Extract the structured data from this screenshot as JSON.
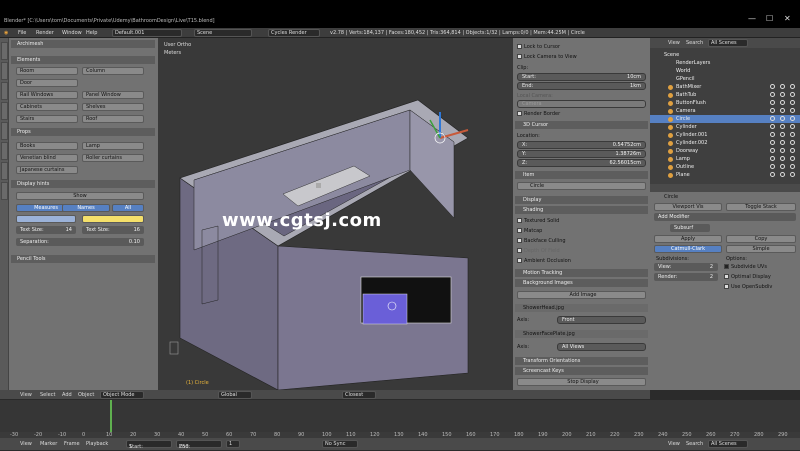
{
  "window": {
    "title": "Blender* [C:\\Users\\tom\\Documents\\Private\\Udemy\\BathroomDesign\\Live\\T15.blend]",
    "minimize": "—",
    "maximize": "☐",
    "close": "✕"
  },
  "info_header": {
    "menus": [
      "File",
      "Render",
      "Window",
      "Help"
    ],
    "layout": "Default.001",
    "scene": "Scene",
    "engine": "Cycles Render",
    "stats": "v2.78 | Verts:184,137 | Faces:180,452 | Tris:364,814 | Objects:1/32 | Lamps:0/0 | Mem:44.25M | Circle"
  },
  "tool_shelf": {
    "addon_header": "Archimesh",
    "elements_header": "Elements",
    "elements": [
      "Room",
      "Column",
      "Door",
      "Rail Windows",
      "Panel Window",
      "Cabinets",
      "Shelves",
      "Stairs",
      "Roof"
    ],
    "props_header": "Props",
    "props": [
      "Books",
      "Lamp",
      "Venetian blind",
      "Roller curtains",
      "Japanese curtains"
    ],
    "display_header": "Display hints",
    "show_label": "Show",
    "measures_label": "Measures",
    "names_label": "Names",
    "all_label": "All",
    "text_size_a_label": "Text Size:",
    "text_size_a_value": "14",
    "text_size_b_label": "Text Size:",
    "text_size_b_value": "16",
    "separation_label": "Separation:",
    "separation_value": "0.10",
    "pencil_header": "Pencil Tools"
  },
  "viewport": {
    "view_label": "User Ortho",
    "units_label": "Meters",
    "object_label": "(1) Circle",
    "watermark": "www.cgtsj.com"
  },
  "n_panel": {
    "lock_to_cursor": "Lock to Cursor",
    "lock_camera": "Lock Camera to View",
    "clip_label": "Clip:",
    "clip_start_label": "Start:",
    "clip_start_value": "10cm",
    "clip_end_label": "End:",
    "clip_end_value": "1km",
    "local_camera_label": "Local Camera:",
    "camera_field": "Camera",
    "render_border": "Render Border",
    "cursor_header": "3D Cursor",
    "location_label": "Location:",
    "loc_x_label": "X:",
    "loc_x_value": "0.54752cm",
    "loc_y_label": "Y:",
    "loc_y_value": "1.38726m",
    "loc_z_label": "Z:",
    "loc_z_value": "62.56015cm",
    "item_header": "Item",
    "item_name": "Circle",
    "display_header": "Display",
    "shading_header": "Shading",
    "textured_solid": "Textured Solid",
    "matcap": "Matcap",
    "backface_culling": "Backface Culling",
    "depth_of_field": "Depth Of Field",
    "ambient_occlusion": "Ambient Occlusion",
    "motion_tracking": "Motion Tracking",
    "bg_images_header": "Background Images",
    "add_image": "Add Image",
    "image1_name": "ShowerHead.jpg",
    "axis_label": "Axis:",
    "image1_axis": "Front",
    "image2_name": "ShowerFacePlate.jpg",
    "image2_axis": "All Views",
    "transform_orientations": "Transform Orientations",
    "screencast_keys": "Screencast Keys",
    "stop_display": "Stop Display"
  },
  "outliner": {
    "view": "View",
    "search": "Search",
    "all_scenes": "All Scenes",
    "items": [
      "Scene",
      "RenderLayers",
      "World",
      "GPencil",
      "BathMixer",
      "BathTub",
      "ButtonFlush",
      "Camera",
      "Circle",
      "Cylinder",
      "Cylinder.001",
      "Cylinder.002",
      "Doorway",
      "Lamp",
      "Outline",
      "Plane"
    ]
  },
  "properties": {
    "breadcrumb": "Circle",
    "viewport_vis": "Viewport Vis",
    "toggle_stack": "Toggle Stack",
    "add_modifier": "Add Modifier",
    "modifier_name": "Subsurf",
    "apply": "Apply",
    "copy": "Copy",
    "catmull": "Catmull-Clark",
    "simple": "Simple",
    "subdivisions_label": "Subdivisions:",
    "view_label": "View:",
    "view_value": "2",
    "render_label": "Render:",
    "render_value": "2",
    "options_label": "Options:",
    "subdivide_uvs": "Subdivide UVs",
    "optimal_display": "Optimal Display",
    "use_opensubdiv": "Use OpenSubdiv",
    "footer_view": "View",
    "footer_search": "Search",
    "footer_scene": "All Scenes"
  },
  "viewport_header": {
    "menus": [
      "View",
      "Select",
      "Add",
      "Object"
    ],
    "mode": "Object Mode",
    "pivot": "Global",
    "snap": "Closest"
  },
  "timeline": {
    "menus": [
      "View",
      "Marker",
      "Frame",
      "Playback"
    ],
    "start_label": "Start:",
    "start_value": "1",
    "end_label": "End:",
    "end_value": "250",
    "current": "1",
    "sync": "No Sync",
    "ruler": [
      "-30",
      "-20",
      "-10",
      "0",
      "10",
      "20",
      "30",
      "40",
      "50",
      "60",
      "70",
      "80",
      "90",
      "100",
      "110",
      "120",
      "130",
      "140",
      "150",
      "160",
      "170",
      "180",
      "190",
      "200",
      "210",
      "220",
      "230",
      "240",
      "250",
      "260",
      "270",
      "280",
      "290"
    ]
  },
  "colors": {
    "accent_blue": "#5680c2",
    "accent_yellow": "#f5e06a",
    "room_fill": "#7b7690"
  }
}
